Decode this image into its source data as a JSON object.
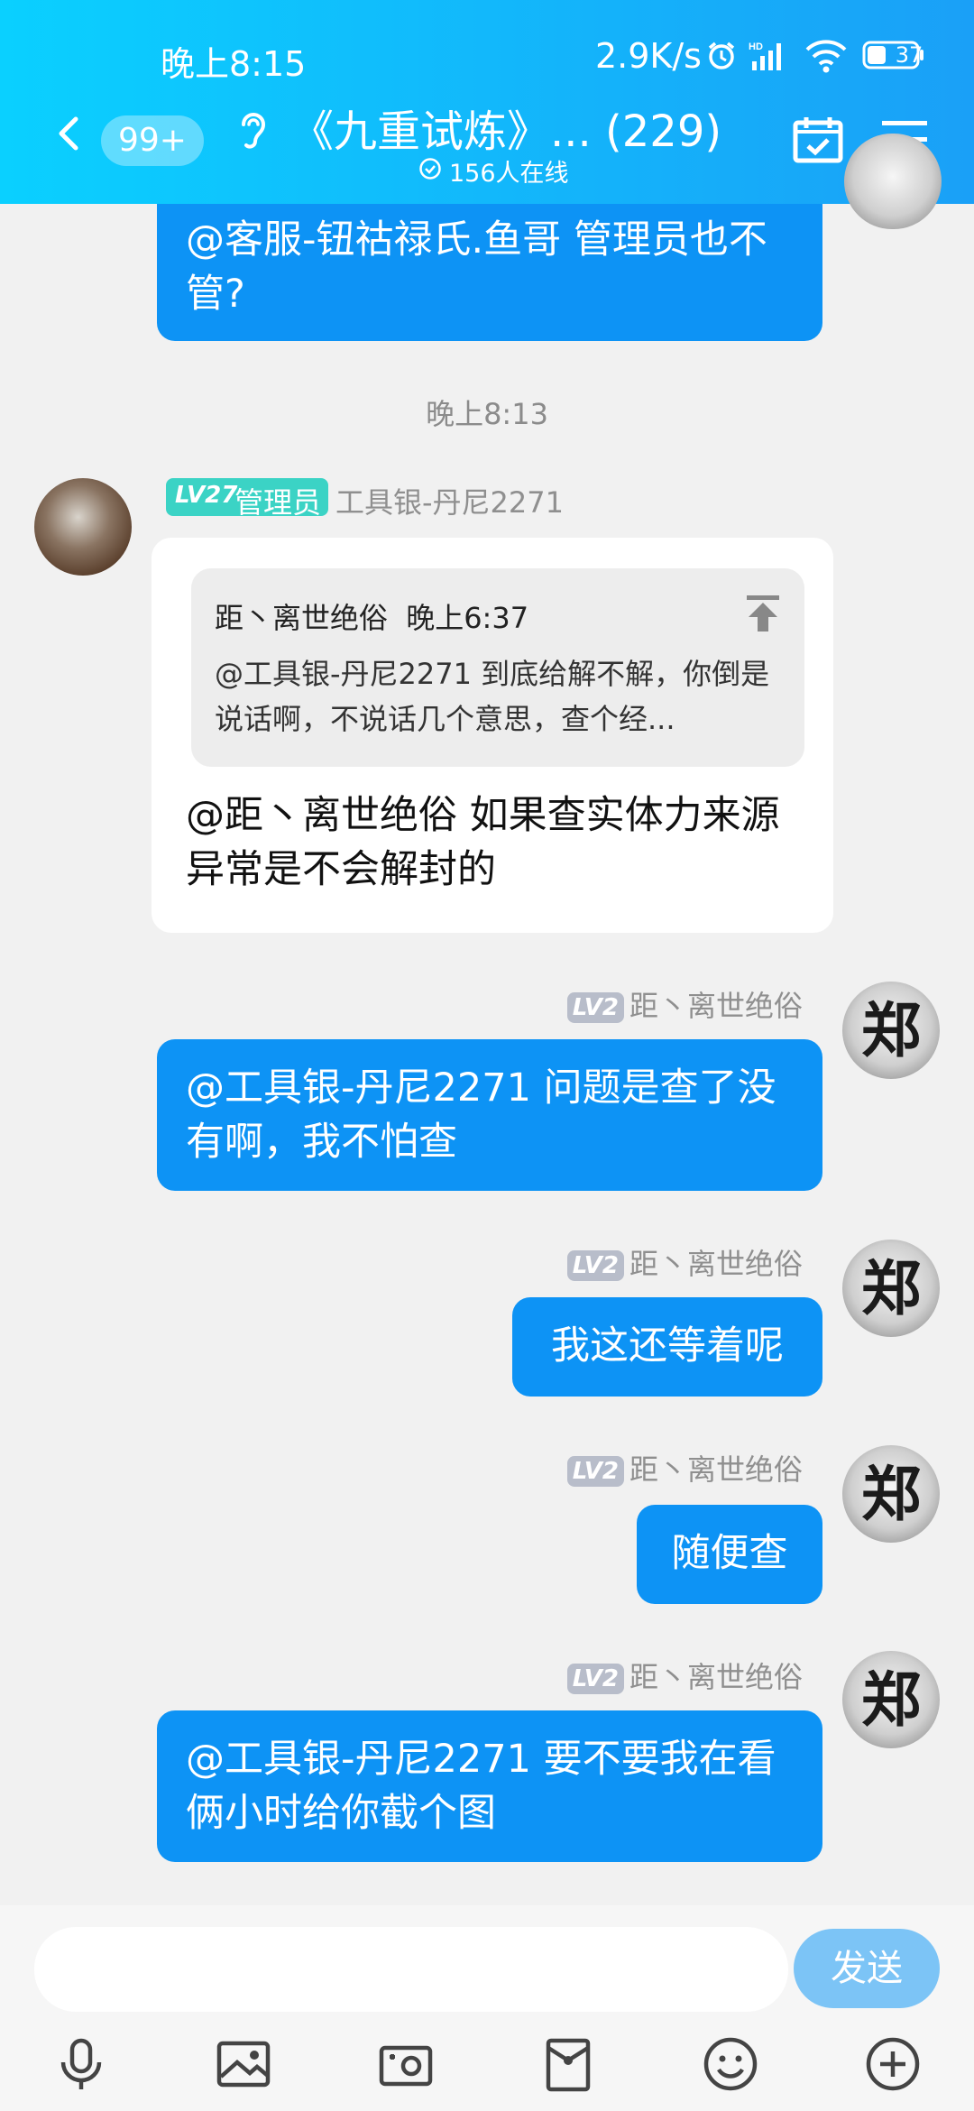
{
  "status_bar": {
    "time": "晚上8:15",
    "net_speed": "2.9K/s",
    "battery": "37"
  },
  "header": {
    "unread_badge": "99+",
    "group_title": "《九重试炼》... (229)",
    "online_count": "156人在线"
  },
  "messages": [
    {
      "side": "right",
      "text": "@客服-钮祜禄氏.鱼哥 管理员也不管?"
    },
    {
      "type": "time",
      "text": "晚上8:13"
    },
    {
      "side": "left",
      "level": "LV27",
      "role": "管理员",
      "sender": "工具银-丹尼2271",
      "quote": {
        "author": "距丶离世绝俗",
        "time": "晚上6:37",
        "text": "@工具银-丹尼2271 到底给解不解，你倒是说话啊，不说话几个意思，查个经..."
      },
      "text": "@距丶离世绝俗 如果查实体力来源异常是不会解封的"
    },
    {
      "side": "right",
      "level": "LV2",
      "sender": "距丶离世绝俗",
      "avatar_char": "郑",
      "text": "@工具银-丹尼2271 问题是查了没有啊，我不怕查"
    },
    {
      "side": "right",
      "level": "LV2",
      "sender": "距丶离世绝俗",
      "avatar_char": "郑",
      "text": "我这还等着呢"
    },
    {
      "side": "right",
      "level": "LV2",
      "sender": "距丶离世绝俗",
      "avatar_char": "郑",
      "text": "随便查"
    },
    {
      "side": "right",
      "level": "LV2",
      "sender": "距丶离世绝俗",
      "avatar_char": "郑",
      "text": "@工具银-丹尼2271 要不要我在看俩小时给你截个图"
    }
  ],
  "input": {
    "placeholder": "",
    "send_label": "发送"
  },
  "toolbar": {
    "icons": [
      "microphone-icon",
      "image-icon",
      "camera-icon",
      "red-packet-icon",
      "emoji-icon",
      "plus-icon"
    ]
  },
  "colors": {
    "header_start": "#0ad0ff",
    "header_end": "#1aa0f7",
    "bubble_blue": "#0d93f5",
    "send_button": "#7cc4f6",
    "admin_badge": "#3bd3c5"
  }
}
